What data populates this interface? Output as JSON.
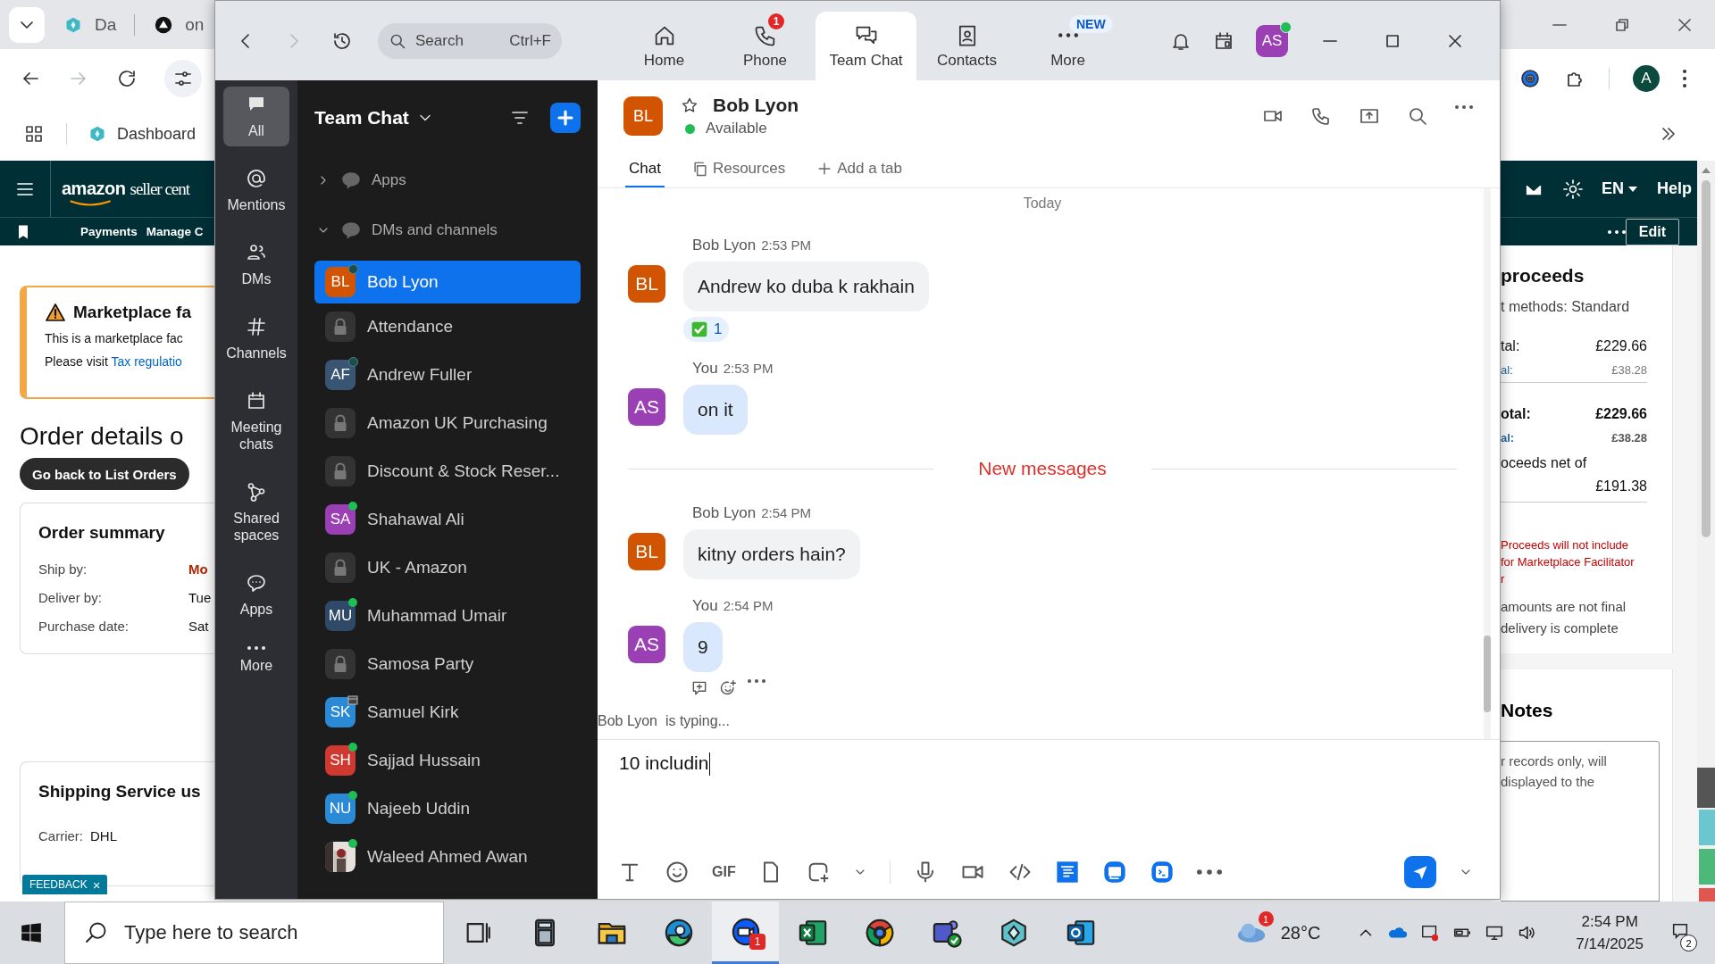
{
  "browser": {
    "tabs": [
      {
        "label": "Da"
      },
      {
        "label": "on"
      }
    ],
    "bookmark": "Dashboard",
    "profile": "A",
    "amazon": {
      "logo_brand": "amazon",
      "logo_rest": "seller cent",
      "lang": "EN",
      "help": "Help",
      "nav": [
        "Payments",
        "Manage C"
      ],
      "edit": "Edit"
    },
    "left": {
      "alert_title": "Marketplace fa",
      "alert_line": "This is a marketplace fac",
      "alert_prefix": "Please visit",
      "alert_link": "Tax regulatio",
      "heading": "Order details o",
      "back_button": "Go back to List Orders",
      "summary_title": "Order summary",
      "summary_rows": [
        {
          "label": "Ship by:",
          "value": "Mo",
          "urgent": true
        },
        {
          "label": "Deliver by:",
          "value": "Tue",
          "urgent": false
        },
        {
          "label": "Purchase date:",
          "value": "Sat",
          "urgent": false
        }
      ],
      "shipping_title": "Shipping Service us",
      "carrier_label": "Carrier:",
      "carrier_value": "DHL",
      "feedback": "FEEDBACK",
      "feedback_close": "×"
    },
    "right": {
      "title": "proceeds",
      "methods": "t methods: Standard",
      "rows": [
        {
          "label": "tal:",
          "value": "£229.66",
          "kind": "main"
        },
        {
          "label": "al:",
          "value": "£38.28",
          "kind": "sub"
        },
        {
          "label": "otal:",
          "value": "£229.66",
          "kind": "main_bold"
        },
        {
          "label": "al:",
          "value": "£38.28",
          "kind": "sub_bold"
        }
      ],
      "net_label": "oceeds net of",
      "net_value": "£191.38",
      "warning": [
        "Proceeds will not include",
        "for Marketplace Facilitator",
        "r"
      ],
      "note": [
        "amounts are not final",
        "delivery is complete"
      ],
      "notes_title": "Notes",
      "notes_placeholder": [
        "r records only, will",
        "displayed to the"
      ]
    }
  },
  "zoom": {
    "search": {
      "placeholder": "Search",
      "shortcut": "Ctrl+F"
    },
    "tabs": [
      {
        "label": "Home",
        "selected": false
      },
      {
        "label": "Phone",
        "selected": false,
        "badge": "1"
      },
      {
        "label": "Team Chat",
        "selected": true
      },
      {
        "label": "Contacts",
        "selected": false
      },
      {
        "label": "More",
        "selected": false,
        "tag": "NEW"
      }
    ],
    "user": {
      "initials": "AS",
      "color": "#9b3fb5",
      "online": true
    },
    "rail": [
      {
        "label": "All",
        "selected": true
      },
      {
        "label": "Mentions",
        "selected": false
      },
      {
        "label": "DMs",
        "selected": false
      },
      {
        "label": "Channels",
        "selected": false
      },
      {
        "label": "Meeting chats",
        "selected": false
      },
      {
        "label": "Shared spaces",
        "selected": false
      },
      {
        "label": "Apps",
        "selected": false
      },
      {
        "label": "More",
        "selected": false
      }
    ],
    "panel": {
      "title": "Team Chat",
      "sections": [
        {
          "label": "Apps",
          "expanded": false
        },
        {
          "label": "DMs and channels",
          "expanded": true
        }
      ],
      "items": [
        {
          "kind": "dm",
          "label": "Bob Lyon",
          "initials": "BL",
          "color": "#d35400",
          "online": false,
          "in_meeting": false,
          "selected": true
        },
        {
          "kind": "channel",
          "label": "Attendance",
          "selected": false
        },
        {
          "kind": "dm",
          "label": "Andrew Fuller",
          "initials": "AF",
          "color": "#3a5573",
          "online": false,
          "in_meeting": false,
          "selected": false
        },
        {
          "kind": "channel",
          "label": "Amazon UK Purchasing",
          "selected": false
        },
        {
          "kind": "channel",
          "label": "Discount & Stock Reser...",
          "selected": false
        },
        {
          "kind": "dm",
          "label": "Shahawal Ali",
          "initials": "SA",
          "color": "#9b3fb5",
          "online": true,
          "in_meeting": false,
          "selected": false
        },
        {
          "kind": "channel",
          "label": "UK - Amazon",
          "selected": false
        },
        {
          "kind": "dm",
          "label": "Muhammad Umair",
          "initials": "MU",
          "color": "#2e4a68",
          "online": true,
          "in_meeting": false,
          "selected": false
        },
        {
          "kind": "channel",
          "label": "Samosa Party",
          "selected": false
        },
        {
          "kind": "dm",
          "label": "Samuel Kirk",
          "initials": "SK",
          "color": "#2b8ad6",
          "online": false,
          "in_meeting": true,
          "selected": false
        },
        {
          "kind": "dm",
          "label": "Sajjad Hussain",
          "initials": "SH",
          "color": "#d0392f",
          "online": true,
          "in_meeting": false,
          "selected": false
        },
        {
          "kind": "dm",
          "label": "Najeeb Uddin",
          "initials": "NU",
          "color": "#2b8ad6",
          "online": true,
          "in_meeting": false,
          "selected": false
        },
        {
          "label": "Waleed Ahmed Awan",
          "online": true,
          "in_meeting": false,
          "selected": false
        }
      ]
    },
    "chat": {
      "contact": {
        "name": "Bob Lyon",
        "initials": "BL",
        "color": "#d35400",
        "status": "Available"
      },
      "tabs": [
        {
          "label": "Chat",
          "selected": true
        },
        {
          "label": "Resources",
          "selected": false
        },
        {
          "label": "Add a tab",
          "selected": false
        }
      ],
      "day": "Today",
      "items": [
        {
          "kind": "message",
          "sender": "Bob Lyon",
          "time": "2:53 PM",
          "initials": "BL",
          "color": "#d35400",
          "mine": false,
          "text": "Andrew ko duba k rakhain",
          "reactions": [
            {
              "count": "1"
            }
          ],
          "hovered": false
        },
        {
          "kind": "message",
          "sender": "You",
          "time": "2:53 PM",
          "initials": "AS",
          "color": "#9b3fb5",
          "mine": true,
          "text": "on it",
          "hovered": false
        },
        {
          "kind": "divider",
          "text": "New messages"
        },
        {
          "kind": "message",
          "sender": "Bob Lyon",
          "time": "2:54 PM",
          "initials": "BL",
          "color": "#d35400",
          "mine": false,
          "text": "kitny orders hain?",
          "hovered": false
        },
        {
          "kind": "message",
          "sender": "You",
          "time": "2:54 PM",
          "initials": "AS",
          "color": "#9b3fb5",
          "mine": true,
          "text": "9",
          "hovered": true
        }
      ],
      "typing": {
        "name": "Bob Lyon",
        "text": "is typing..."
      },
      "compose": {
        "value": "10 includin",
        "gif": "GIF"
      }
    }
  },
  "taskbar": {
    "search": "Type here to search",
    "apps": [
      {
        "kind": "taskview",
        "active": false
      },
      {
        "kind": "calculator",
        "active": false
      },
      {
        "kind": "folder",
        "active": false
      },
      {
        "kind": "edge",
        "active": false
      },
      {
        "kind": "zoom",
        "active": true,
        "badge": "1"
      },
      {
        "kind": "excel",
        "active": false
      },
      {
        "kind": "chrome",
        "active": false
      },
      {
        "kind": "teams",
        "active": false
      },
      {
        "kind": "hex",
        "active": false
      },
      {
        "kind": "outlook",
        "active": false
      }
    ],
    "weather_badge": "1",
    "temperature": "28°C",
    "time": "2:54 PM",
    "date": "7/14/2025",
    "notifications": "2"
  }
}
